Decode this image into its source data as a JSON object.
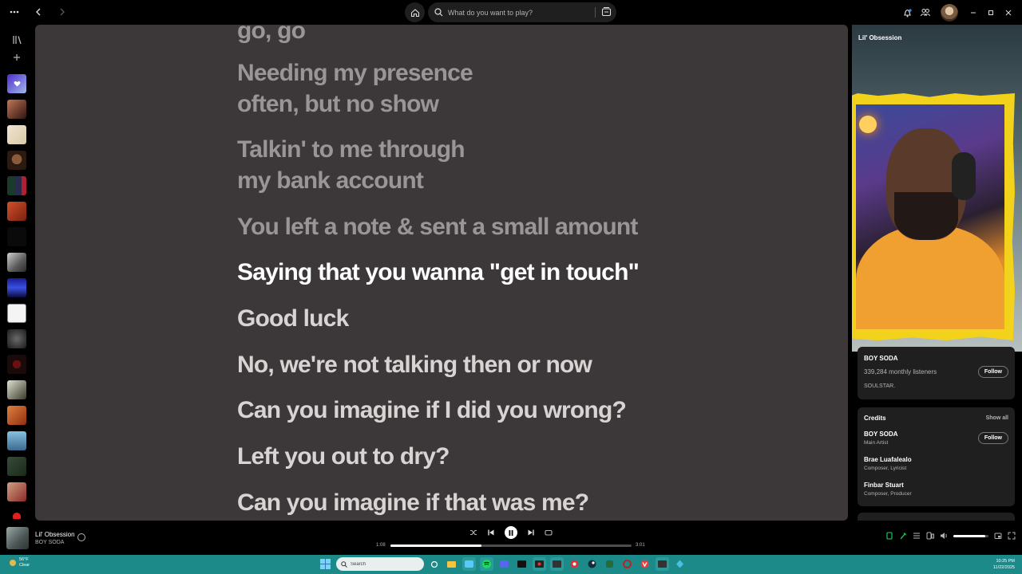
{
  "search": {
    "placeholder": "What do you want to play?"
  },
  "lyrics": [
    {
      "text": "go, go",
      "state": "past"
    },
    {
      "text": "Needing my presence",
      "state": "past"
    },
    {
      "text": "often, but no show",
      "state": "past"
    },
    {
      "text": "Talkin' to me through",
      "state": "past"
    },
    {
      "text": "my bank account",
      "state": "past"
    },
    {
      "text": "You left a note & sent a small amount",
      "state": "past"
    },
    {
      "text": "Saying that you wanna \"get in touch\"",
      "state": "active"
    },
    {
      "text": "Good luck",
      "state": "future"
    },
    {
      "text": "No, we're not talking then or now",
      "state": "future"
    },
    {
      "text": "Can you imagine if I did you wrong?",
      "state": "future"
    },
    {
      "text": "Left you out to dry?",
      "state": "future"
    },
    {
      "text": "Can you imagine if that was me?",
      "state": "future"
    }
  ],
  "now_playing": {
    "title": "Lil' Obsession",
    "artist_card": {
      "name": "BOY SODA",
      "listeners": "339,284 monthly listeners",
      "follow_label": "Follow",
      "bio": "SOULSTAR."
    },
    "credits": {
      "title": "Credits",
      "show_all": "Show all",
      "follow_label": "Follow",
      "people": [
        {
          "name": "BOY SODA",
          "role": "Main Artist"
        },
        {
          "name": "Brae Luafalealo",
          "role": "Composer, Lyricist"
        },
        {
          "name": "Finbar Stuart",
          "role": "Composer, Producer"
        }
      ]
    }
  },
  "player": {
    "track": "Lil' Obsession",
    "artist": "BOY SODA",
    "current_time": "1:08",
    "total_time": "3:01",
    "progress": 0.376,
    "volume": 0.9
  },
  "taskbar": {
    "weather_temp": "56°F",
    "weather_desc": "Clear",
    "search_placeholder": "Search",
    "time": "10:25 PM",
    "date": "11/22/2025"
  },
  "colors": {
    "lyrics_bg": "#3c3839",
    "lyric_active": "#ffffff",
    "lyric_past": "#9a9596",
    "lyric_future": "#d8d4d4",
    "taskbar": "#1d8a8a",
    "webcam_border": "#f2d21a"
  },
  "icons": [
    "menu-icon",
    "back-icon",
    "forward-icon",
    "home-icon",
    "search-icon",
    "browse-icon",
    "bell-icon",
    "friends-icon",
    "minimize-icon",
    "maximize-icon",
    "close-icon",
    "library-icon",
    "plus-icon",
    "shuffle-icon",
    "previous-icon",
    "pause-icon",
    "next-icon",
    "repeat-icon",
    "now-playing-view-icon",
    "lyrics-icon",
    "queue-icon",
    "connect-device-icon",
    "volume-icon",
    "miniplayer-icon",
    "fullscreen-icon"
  ]
}
